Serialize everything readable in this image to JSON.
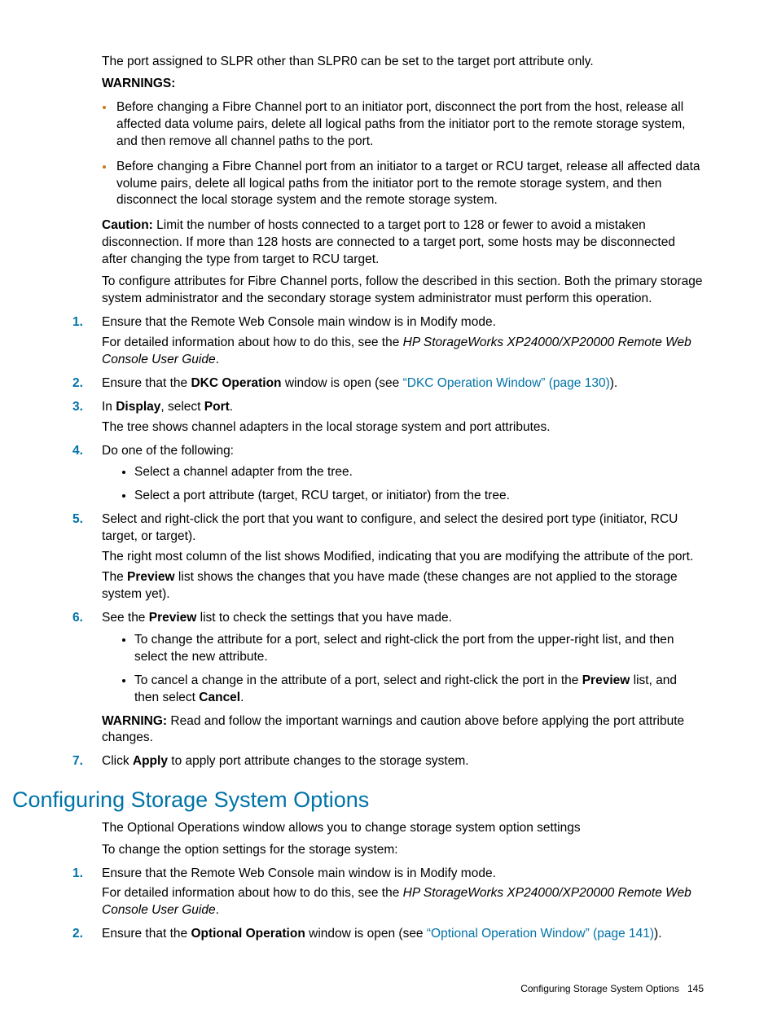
{
  "intro": {
    "p1": "The port assigned to SLPR other than SLPR0 can be set to the target port attribute only.",
    "warnings_label": "WARNINGS:",
    "warn1": "Before changing a Fibre Channel port to an initiator port, disconnect the port from the host, release all affected data volume pairs, delete all logical paths from the initiator port to the remote storage system, and then remove all channel paths to the port.",
    "warn2": "Before changing a Fibre Channel port from an initiator to a target or RCU target, release all affected data volume pairs, delete all logical paths from the initiator port to the remote storage system, and then disconnect the local storage system and the remote storage system.",
    "caution_label": "Caution:",
    "caution_text": " Limit the number of hosts connected to a target port to 128 or fewer to avoid a mistaken disconnection. If more than 128 hosts are connected to a target port, some hosts may be disconnected after changing the type from target to RCU target.",
    "config_text": "To configure attributes for Fibre Channel ports, follow the described in this section. Both the primary storage system administrator and the secondary storage system administrator must perform this operation."
  },
  "steps1": {
    "s1_a": "Ensure that the Remote Web Console main window is in Modify mode.",
    "s1_b_pre": "For detailed information about how to do this, see the ",
    "s1_b_ital": "HP StorageWorks XP24000/XP20000 Remote Web Console User Guide",
    "s1_b_post": ".",
    "s2_pre": "Ensure that the ",
    "s2_bold": "DKC Operation",
    "s2_mid": " window is open (see ",
    "s2_link": "“DKC Operation Window” (page 130)",
    "s2_post": ").",
    "s3_a": "In ",
    "s3_b": "Display",
    "s3_c": ", select ",
    "s3_d": "Port",
    "s3_e": ".",
    "s3_p": "The tree shows channel adapters in the local storage system and port attributes.",
    "s4": "Do one of the following:",
    "s4_b1": "Select a channel adapter from the tree.",
    "s4_b2": "Select a port attribute (target, RCU target, or initiator) from the tree.",
    "s5_a": "Select and right-click the port that you want to configure, and select the desired port type (initiator, RCU target, or target).",
    "s5_b": "The right most column of the list shows Modified, indicating that you are modifying the attribute of the port.",
    "s5_c_pre": "The ",
    "s5_c_bold": "Preview",
    "s5_c_post": " list shows the changes that you have made (these changes are not applied to the storage system yet).",
    "s6_pre": "See the ",
    "s6_bold": "Preview",
    "s6_post": " list to check the settings that you have made.",
    "s6_b1": "To change the attribute for a port, select and right-click the port from the upper-right list, and then select the new attribute.",
    "s6_b2_pre": "To cancel a change in the attribute of a port, select and right-click the port in the ",
    "s6_b2_bold1": "Preview",
    "s6_b2_mid": " list, and then select ",
    "s6_b2_bold2": "Cancel",
    "s6_b2_post": ".",
    "s6_warn_label": "WARNING:",
    "s6_warn_text": " Read and follow the important warnings and caution above before applying the port attribute changes.",
    "s7_pre": "Click ",
    "s7_bold": "Apply",
    "s7_post": " to apply port attribute changes to the storage system."
  },
  "section2": {
    "heading": "Configuring Storage System Options",
    "p1": "The Optional Operations window allows you to change storage system option settings",
    "p2": "To change the option settings for the storage system:",
    "s1_a": "Ensure that the Remote Web Console main window is in Modify mode.",
    "s1_b_pre": "For detailed information about how to do this, see the ",
    "s1_b_ital": "HP StorageWorks XP24000/XP20000 Remote Web Console User Guide",
    "s1_b_post": ".",
    "s2_pre": "Ensure that the ",
    "s2_bold": "Optional Operation",
    "s2_mid": " window is open (see ",
    "s2_link": "“Optional Operation Window” (page 141)",
    "s2_post": ")."
  },
  "footer": {
    "text": "Configuring Storage System Options",
    "page": "145"
  }
}
